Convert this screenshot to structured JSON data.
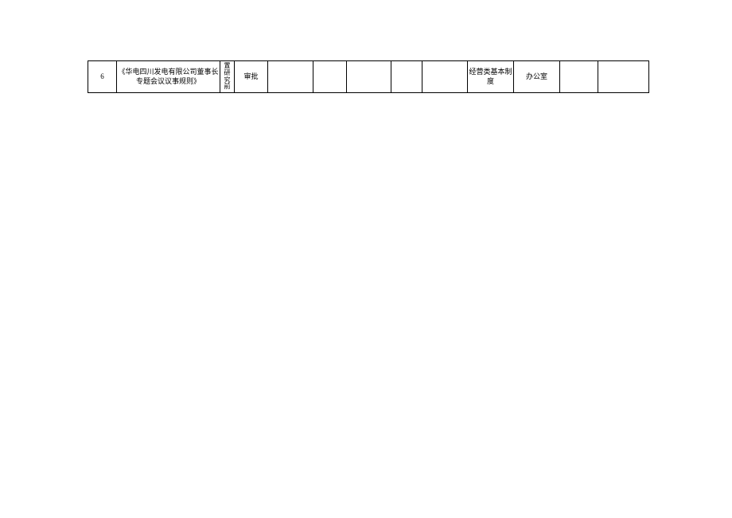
{
  "table": {
    "rows": [
      {
        "index": "6",
        "title": "《华电四川发电有限公司董事长专题会议议事规则》",
        "stage": "置研究前",
        "action": "审批",
        "c4": "",
        "c5": "",
        "c6": "",
        "c7": "",
        "c8": "",
        "category": "经营类基本制度",
        "department": "办公室",
        "c11": "",
        "c12": ""
      }
    ]
  }
}
